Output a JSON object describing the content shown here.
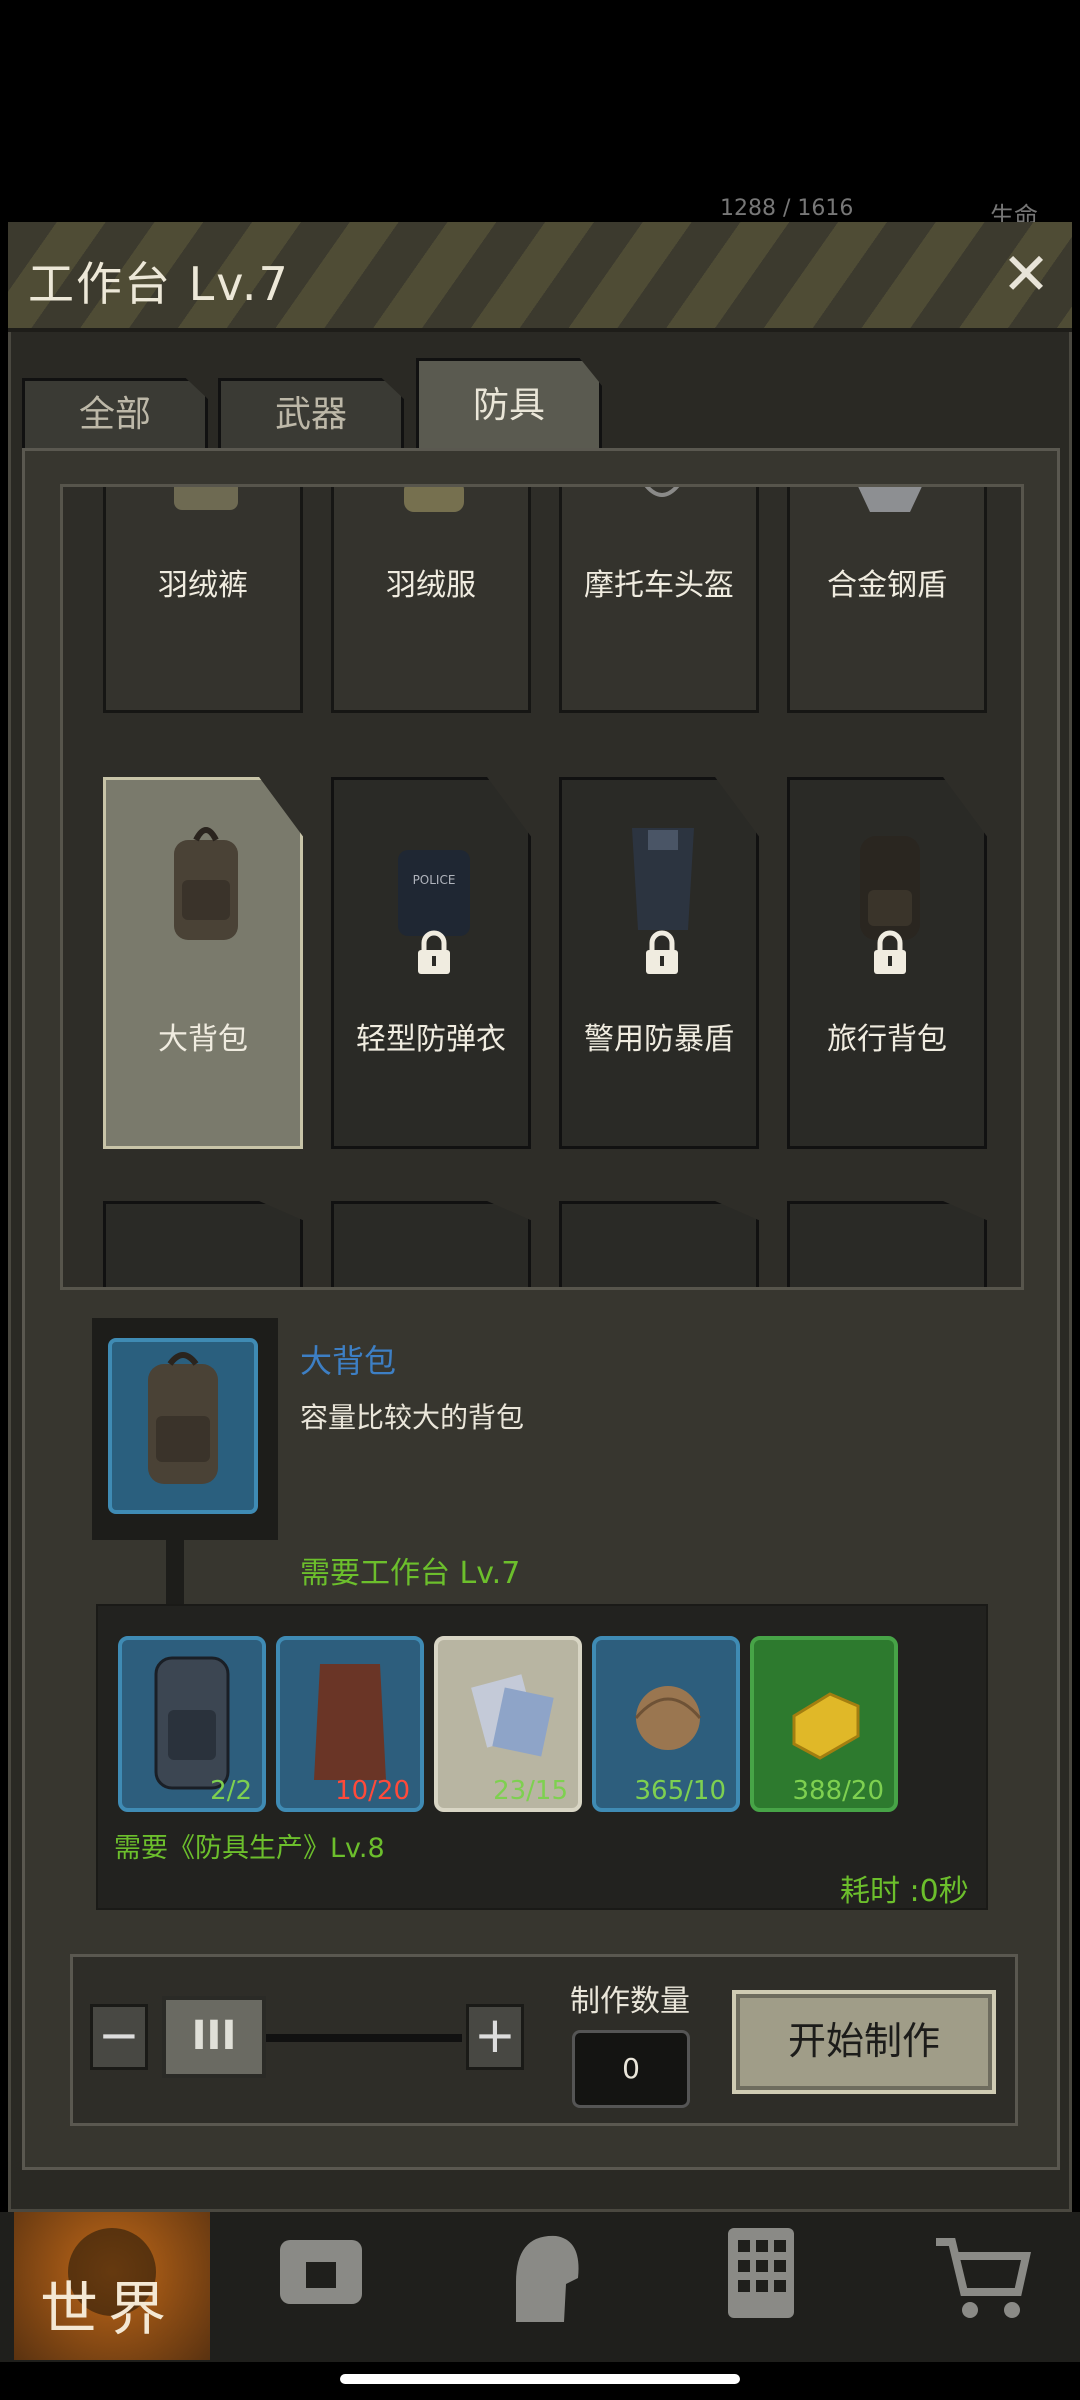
{
  "status_bar": {
    "resource": "1288 / 1616",
    "right_label": "生命"
  },
  "window": {
    "title": "工作台 Lv.7",
    "close": "✕"
  },
  "tabs": [
    {
      "label": "全部",
      "active": false
    },
    {
      "label": "武器",
      "active": false
    },
    {
      "label": "防具",
      "active": true
    }
  ],
  "grid_rows": [
    [
      {
        "label": "羽绒裤",
        "locked": false,
        "icon": "down-pants-icon"
      },
      {
        "label": "羽绒服",
        "locked": false,
        "icon": "down-jacket-icon"
      },
      {
        "label": "摩托车头盔",
        "locked": false,
        "icon": "motorcycle-helmet-icon"
      },
      {
        "label": "合金钢盾",
        "locked": false,
        "icon": "alloy-shield-icon"
      }
    ],
    [
      {
        "label": "大背包",
        "locked": false,
        "selected": true,
        "icon": "large-backpack-icon"
      },
      {
        "label": "轻型防弹衣",
        "locked": true,
        "icon": "police-vest-icon"
      },
      {
        "label": "警用防暴盾",
        "locked": true,
        "icon": "riot-shield-icon"
      },
      {
        "label": "旅行背包",
        "locked": true,
        "icon": "travel-backpack-icon"
      }
    ]
  ],
  "detail": {
    "name": "大背包",
    "description": "容量比较大的背包",
    "require_workbench": "需要工作台 Lv.7",
    "materials": [
      {
        "count": "2/2",
        "color": "blue",
        "enough": true,
        "icon": "backpack-material-icon"
      },
      {
        "count": "10/20",
        "color": "blue",
        "enough": false,
        "icon": "leather-icon"
      },
      {
        "count": "23/15",
        "color": "tan",
        "enough": true,
        "icon": "cloth-icon"
      },
      {
        "count": "365/10",
        "color": "blue",
        "enough": true,
        "icon": "yarn-icon"
      },
      {
        "count": "388/20",
        "color": "green",
        "enough": true,
        "icon": "gold-bar-icon"
      }
    ],
    "require_skill": "需要《防具生产》Lv.8",
    "time": "耗时 :0秒"
  },
  "controls": {
    "minus": "−",
    "plus": "+",
    "slider_handle": "III",
    "quantity_label": "制作数量",
    "quantity": "0",
    "start": "开始制作"
  },
  "nav": {
    "world": "世界"
  }
}
